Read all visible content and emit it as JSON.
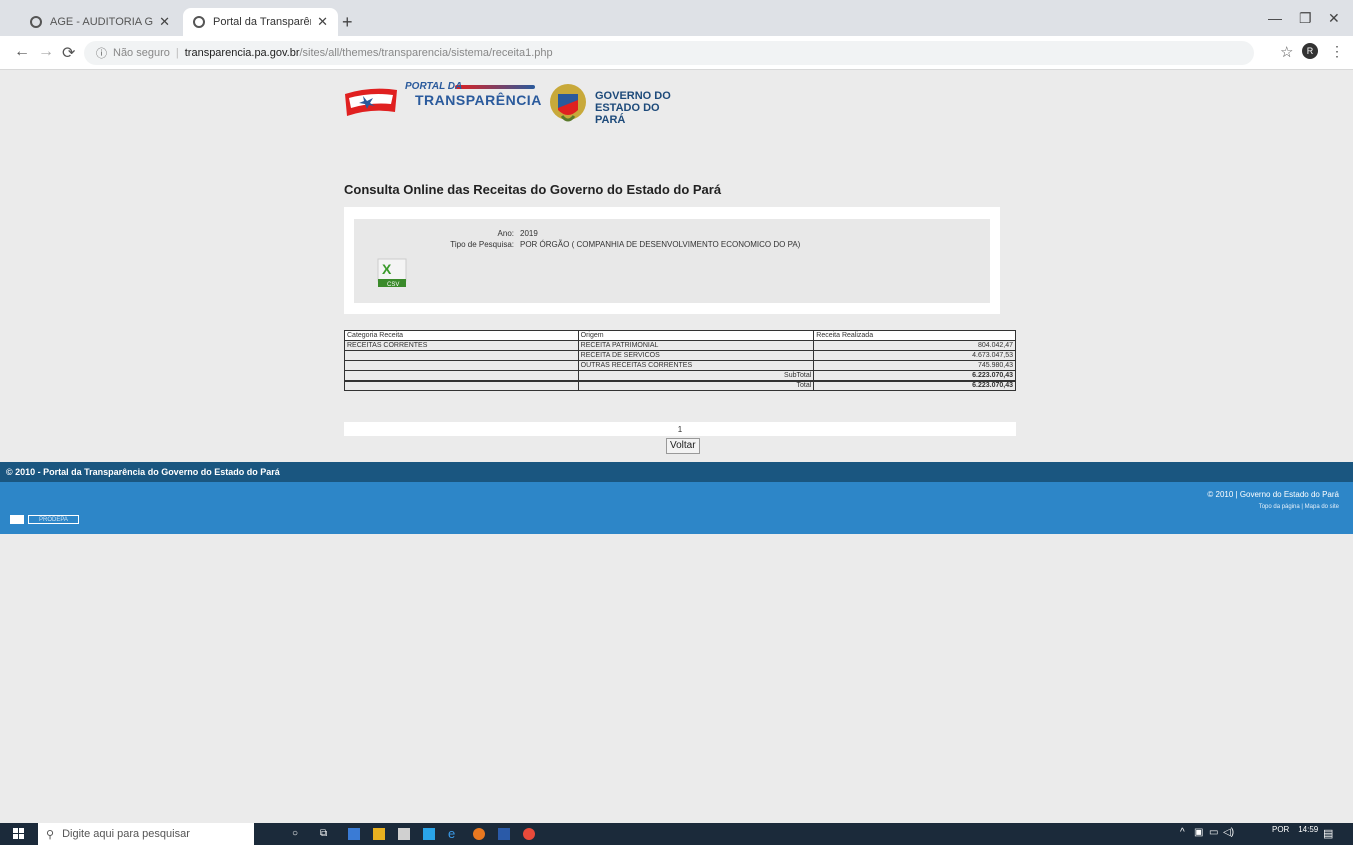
{
  "browser": {
    "tabs": [
      {
        "title": "AGE - AUDITORIA GERAL DO E",
        "active": false
      },
      {
        "title": "Portal da Transparência",
        "active": true
      }
    ],
    "new_tab": "+",
    "url_info_icon": "info-icon",
    "url_security": "Não seguro",
    "url_separator": "|",
    "url_host": "transparencia.pa.gov.br",
    "url_path": "/sites/all/themes/transparencia/sistema/receita1.php",
    "profile_initial": "R"
  },
  "header": {
    "portal_small": "PORTAL DA",
    "portal_big": "TRANSPARÊNCIA",
    "gov_line1": "GOVERNO DO",
    "gov_line2": "ESTADO DO PARÁ"
  },
  "page": {
    "title": "Consulta Online das Receitas do Governo do Estado do Pará",
    "info": {
      "ano_label": "Ano:",
      "ano_value": "2019",
      "tipo_label": "Tipo de Pesquisa:",
      "tipo_value": "POR ÓRGÃO ( COMPANHIA DE DESENVOLVIMENTO ECONOMICO DO PA)",
      "export_label": "CSV"
    },
    "table": {
      "headers": [
        "Categoria Receita",
        "Origem",
        "Receita Realizada"
      ],
      "rows": [
        {
          "categoria": "RECEITAS CORRENTES",
          "origem": "RECEITA PATRIMONIAL",
          "valor": "804.042,47"
        },
        {
          "categoria": "",
          "origem": "RECEITA DE SERVICOS",
          "valor": "4.673.047,53"
        },
        {
          "categoria": "",
          "origem": "OUTRAS RECEITAS CORRENTES",
          "valor": "745.980,43"
        }
      ],
      "subtotal_label": "SubTotal",
      "subtotal_value": "6.223.070,43",
      "total_label": "Total",
      "total_value": "6.223.070,43"
    },
    "pagination": "1",
    "back_button": "Voltar"
  },
  "footer": {
    "top_text": "© 2010 - Portal da Transparência do Governo do Estado do Pará",
    "copyright": "© 2010 | Governo do Estado do Pará",
    "link_top": "Topo da página",
    "link_sep": "|",
    "link_map": "Mapa do site",
    "prodepa": "PRODEPA"
  },
  "taskbar": {
    "search_placeholder": "Digite aqui para pesquisar",
    "language": "POR",
    "time": "14:59"
  },
  "colors": {
    "footer_dark": "#1a5680",
    "footer_light": "#2d86c8",
    "portal_blue": "#2a5a9c",
    "taskbar": "#1b2a3a"
  }
}
